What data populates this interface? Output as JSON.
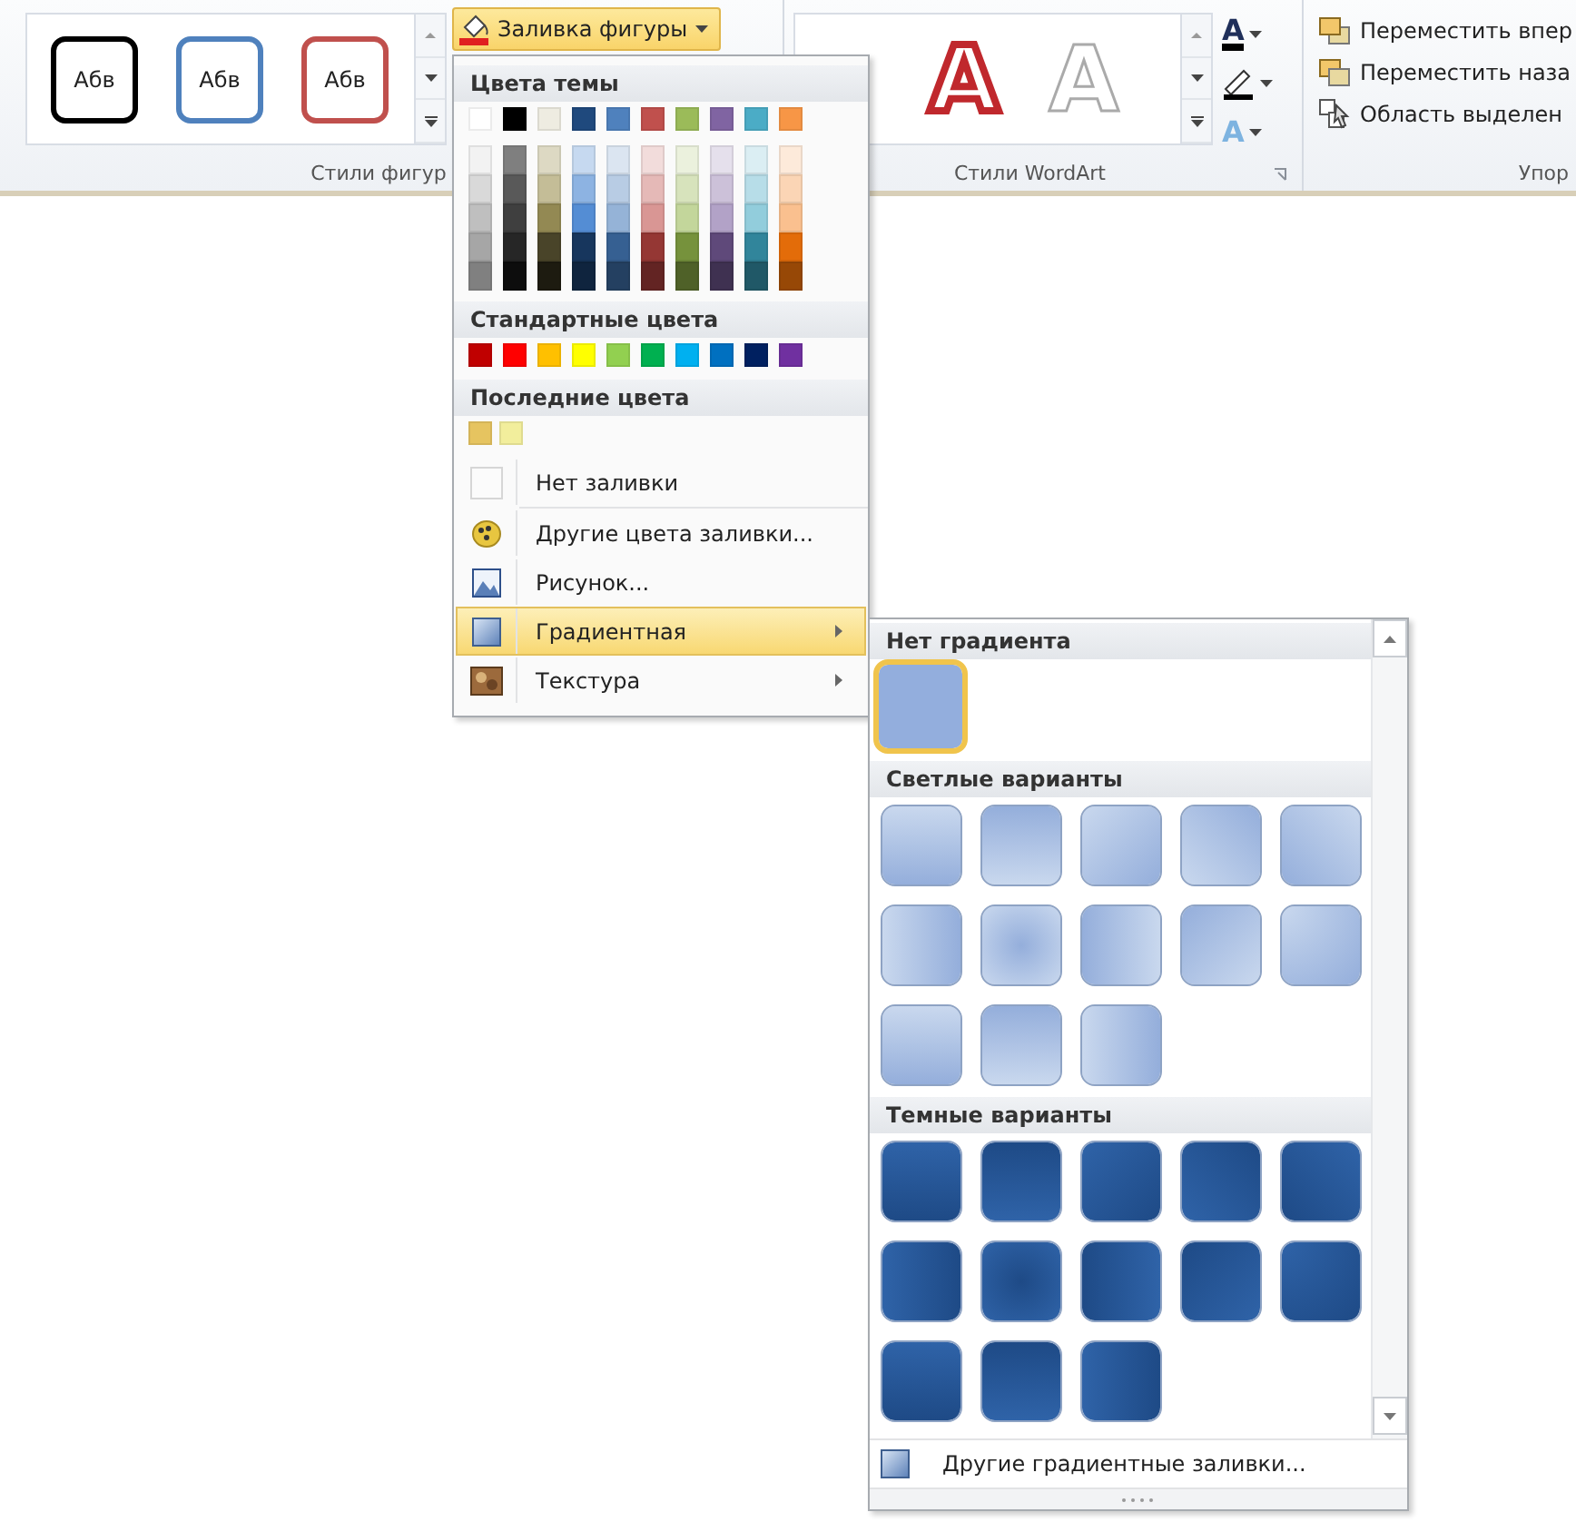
{
  "shape_styles": {
    "label": "Стили фигур",
    "styles": [
      {
        "text": "Абв",
        "color": "#000000"
      },
      {
        "text": "Абв",
        "color": "#4f81bd"
      },
      {
        "text": "Абв",
        "color": "#c0504d"
      }
    ]
  },
  "fill_button": {
    "label": "Заливка фигуры",
    "expanded": true
  },
  "wordart_styles": {
    "label": "Стили WordArt",
    "letters": [
      {
        "text": "A",
        "kind": "red"
      },
      {
        "text": "A",
        "kind": "outline-light"
      }
    ],
    "tools": [
      {
        "kind": "fill",
        "glyph": "A"
      },
      {
        "kind": "outline"
      },
      {
        "kind": "effects",
        "glyph": "A"
      }
    ]
  },
  "arrange": {
    "label": "Упор",
    "items": [
      {
        "label": "Переместить впер",
        "kind": "forward"
      },
      {
        "label": "Переместить наза",
        "kind": "backward"
      },
      {
        "label": "Область выделен",
        "kind": "selection"
      }
    ]
  },
  "fill_menu": {
    "theme_title": "Цвета темы",
    "theme_colors": [
      {
        "color": "#ffffff",
        "shades": [
          {
            "color": "#f2f2f2"
          },
          {
            "color": "#d9d9d9"
          },
          {
            "color": "#bfbfbf"
          },
          {
            "color": "#a6a6a6"
          },
          {
            "color": "#808080"
          }
        ]
      },
      {
        "color": "#000000",
        "shades": [
          {
            "color": "#7f7f7f"
          },
          {
            "color": "#595959"
          },
          {
            "color": "#3f3f3f"
          },
          {
            "color": "#262626"
          },
          {
            "color": "#0d0d0d"
          }
        ]
      },
      {
        "color": "#eeece1",
        "shades": [
          {
            "color": "#ddd9c3"
          },
          {
            "color": "#c4bd97"
          },
          {
            "color": "#938953"
          },
          {
            "color": "#494429"
          },
          {
            "color": "#1d1b10"
          }
        ]
      },
      {
        "color": "#1f497d",
        "shades": [
          {
            "color": "#c6d9f0"
          },
          {
            "color": "#8db3e2"
          },
          {
            "color": "#548dd4"
          },
          {
            "color": "#17365d"
          },
          {
            "color": "#0f243e"
          }
        ]
      },
      {
        "color": "#4f81bd",
        "shades": [
          {
            "color": "#dbe5f1"
          },
          {
            "color": "#b8cce4"
          },
          {
            "color": "#95b3d7"
          },
          {
            "color": "#366092"
          },
          {
            "color": "#244061"
          }
        ]
      },
      {
        "color": "#c0504d",
        "shades": [
          {
            "color": "#f2dcdb"
          },
          {
            "color": "#e5b9b7"
          },
          {
            "color": "#d99694"
          },
          {
            "color": "#953734"
          },
          {
            "color": "#632423"
          }
        ]
      },
      {
        "color": "#9bbb59",
        "shades": [
          {
            "color": "#ebf1dd"
          },
          {
            "color": "#d7e3bc"
          },
          {
            "color": "#c3d69b"
          },
          {
            "color": "#76923c"
          },
          {
            "color": "#4f6128"
          }
        ]
      },
      {
        "color": "#8064a2",
        "shades": [
          {
            "color": "#e5e0ec"
          },
          {
            "color": "#ccc1d9"
          },
          {
            "color": "#b2a2c7"
          },
          {
            "color": "#5f497a"
          },
          {
            "color": "#3f3151"
          }
        ]
      },
      {
        "color": "#4bacc6",
        "shades": [
          {
            "color": "#dbeef3"
          },
          {
            "color": "#b7dde8"
          },
          {
            "color": "#92cddc"
          },
          {
            "color": "#31859b"
          },
          {
            "color": "#205867"
          }
        ]
      },
      {
        "color": "#f79646",
        "shades": [
          {
            "color": "#fdeada"
          },
          {
            "color": "#fbd5b5"
          },
          {
            "color": "#fac08f"
          },
          {
            "color": "#e36c09"
          },
          {
            "color": "#974806"
          }
        ]
      }
    ],
    "standard_title": "Стандартные цвета",
    "standard_colors": [
      {
        "color": "#c00000"
      },
      {
        "color": "#ff0000"
      },
      {
        "color": "#ffc000"
      },
      {
        "color": "#ffff00"
      },
      {
        "color": "#92d050"
      },
      {
        "color": "#00b050"
      },
      {
        "color": "#00b0f0"
      },
      {
        "color": "#0070c0"
      },
      {
        "color": "#002060"
      },
      {
        "color": "#7030a0"
      }
    ],
    "recent_title": "Последние цвета",
    "recent_colors": [
      {
        "color": "#e6c460"
      },
      {
        "color": "#f2ee9c"
      }
    ],
    "items": [
      {
        "label": "Нет заливки",
        "kind": "no-fill",
        "selected": false,
        "submenu": false
      },
      {
        "label": "Другие цвета заливки...",
        "kind": "more-colors",
        "selected": false,
        "submenu": false
      },
      {
        "label": "Рисунок...",
        "kind": "picture",
        "selected": false,
        "submenu": false
      },
      {
        "label": "Градиентная",
        "kind": "gradient",
        "selected": true,
        "submenu": true
      },
      {
        "label": "Текстура",
        "kind": "texture",
        "selected": false,
        "submenu": true
      }
    ]
  },
  "gradient_menu": {
    "sections": [
      {
        "title": "Нет градиента",
        "kind": "flat",
        "swatches": [
          {
            "selected": true
          }
        ]
      },
      {
        "title": "Светлые варианты",
        "kind": "light",
        "swatches": [
          {
            "selected": false
          },
          {
            "selected": false
          },
          {
            "selected": false
          },
          {
            "selected": false
          },
          {
            "selected": false
          },
          {
            "selected": false
          },
          {
            "selected": false
          },
          {
            "selected": false
          },
          {
            "selected": false
          },
          {
            "selected": false
          },
          {
            "selected": false
          },
          {
            "selected": false
          },
          {
            "selected": false
          }
        ]
      },
      {
        "title": "Темные варианты",
        "kind": "dark",
        "swatches": [
          {
            "selected": false
          },
          {
            "selected": false
          },
          {
            "selected": false
          },
          {
            "selected": false
          },
          {
            "selected": false
          },
          {
            "selected": false
          },
          {
            "selected": false
          },
          {
            "selected": false
          },
          {
            "selected": false
          },
          {
            "selected": false
          },
          {
            "selected": false
          },
          {
            "selected": false
          },
          {
            "selected": false
          }
        ]
      }
    ],
    "footer": "Другие градиентные заливки..."
  }
}
